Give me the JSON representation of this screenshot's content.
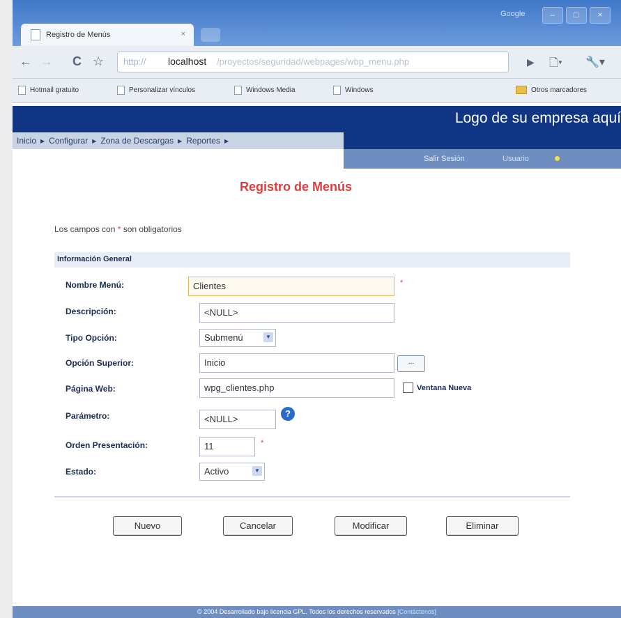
{
  "browser": {
    "tab_title": "Registro de Menús",
    "tab_close": "×",
    "search_brand": "Google",
    "window_controls": {
      "minimize": "–",
      "maximize": "□",
      "close": "×"
    },
    "url": {
      "prefix": "http://",
      "host": "localhost",
      "path": "/proyectos/seguridad/webpages/wbp_menu.php"
    },
    "bookmarks": [
      {
        "label": "Hotmail gratuito"
      },
      {
        "label": "Personalizar vínculos"
      },
      {
        "label": "Windows Media"
      },
      {
        "label": "Windows"
      }
    ],
    "other_bookmarks": "Otros marcadores"
  },
  "header": {
    "logo_text": "Logo de su empresa aquí",
    "menu": [
      "Inicio",
      "Configurar",
      "Zona de Descargas",
      "Reportes"
    ],
    "logout_label": "Salir Sesión",
    "user_label": "Usuario"
  },
  "page": {
    "title": "Registro de Menús",
    "required_note_pre": "Los campos con ",
    "required_note_star": "*",
    "required_note_post": " son obligatorios",
    "section_title": "Información General"
  },
  "form": {
    "nombre_label": "Nombre Menú:",
    "nombre_value": "Clientes",
    "descripcion_label": "Descripción:",
    "descripcion_value": "<NULL>",
    "tipo_label": "Tipo Opción:",
    "tipo_value": "Submenú",
    "superior_label": "Opción Superior:",
    "superior_value": "Inicio",
    "browse_label": "...",
    "pagina_label": "Página Web:",
    "pagina_value": "wpg_clientes.php",
    "ventana_label": "Ventana Nueva",
    "parametro_label": "Parámetro:",
    "parametro_value": "<NULL>",
    "help_symbol": "?",
    "orden_label": "Orden Presentación:",
    "orden_value": "11",
    "estado_label": "Estado:",
    "estado_value": "Activo",
    "required_star": "*"
  },
  "buttons": {
    "nuevo": "Nuevo",
    "cancelar": "Cancelar",
    "modificar": "Modificar",
    "eliminar": "Eliminar"
  },
  "footer": {
    "text": "© 2004 Desarrollado bajo licencia GPL. Todos los derechos reservados",
    "link": "[Contáctenos]"
  },
  "colors": {
    "banner": "#103584",
    "title_red": "#e03b3b",
    "menu_bg": "#c8d3e4",
    "userbar": "#6e8ec2"
  }
}
